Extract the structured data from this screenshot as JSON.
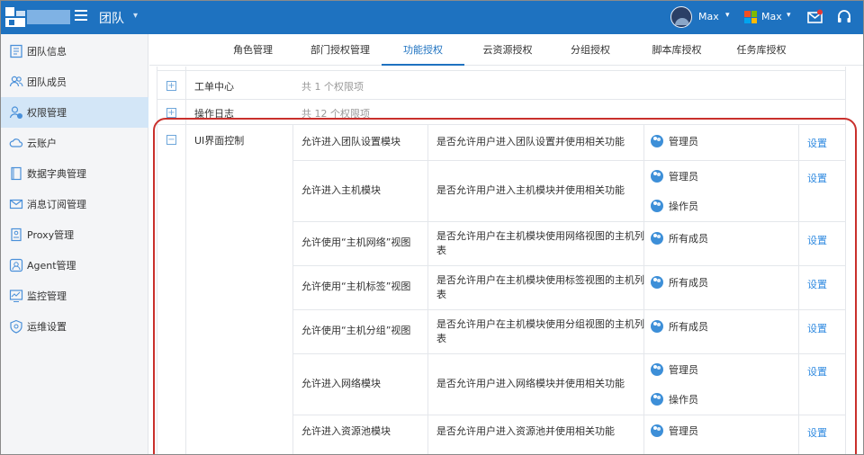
{
  "header": {
    "team_title": "团队",
    "user1_name": "Max",
    "user2_name": "Max"
  },
  "sidebar": {
    "items": [
      {
        "label": "团队信息",
        "icon": "id-card-icon"
      },
      {
        "label": "团队成员",
        "icon": "users-icon"
      },
      {
        "label": "权限管理",
        "icon": "user-permission-icon"
      },
      {
        "label": "云账户",
        "icon": "cloud-icon"
      },
      {
        "label": "数据字典管理",
        "icon": "book-icon"
      },
      {
        "label": "消息订阅管理",
        "icon": "mail-icon"
      },
      {
        "label": "Proxy管理",
        "icon": "proxy-icon"
      },
      {
        "label": "Agent管理",
        "icon": "agent-icon"
      },
      {
        "label": "监控管理",
        "icon": "monitor-icon"
      },
      {
        "label": "运维设置",
        "icon": "shield-gear-icon"
      }
    ]
  },
  "tabs": [
    "角色管理",
    "部门授权管理",
    "功能授权",
    "云资源授权",
    "分组授权",
    "脚本库授权",
    "任务库授权"
  ],
  "groups": [
    {
      "name": "工单中心",
      "count": "共 1 个权限项"
    },
    {
      "name": "操作日志",
      "count": "共 12 个权限项"
    },
    {
      "name": "UI界面控制"
    }
  ],
  "rows": [
    {
      "name": "允许进入团队设置模块",
      "desc": "是否允许用户进入团队设置并使用相关功能",
      "roles": [
        "管理员"
      ],
      "action": "设置"
    },
    {
      "name": "允许进入主机模块",
      "desc": "是否允许用户进入主机模块并使用相关功能",
      "roles": [
        "管理员",
        "操作员"
      ],
      "action": "设置"
    },
    {
      "name": "允许使用“主机网络”视图",
      "desc1": "是否允许用户在主机模块使用网络视图的主机列",
      "desc2": "表",
      "roles": [
        "所有成员"
      ],
      "action": "设置"
    },
    {
      "name": "允许使用“主机标签”视图",
      "desc1": "是否允许用户在主机模块使用标签视图的主机列",
      "desc2": "表",
      "roles": [
        "所有成员"
      ],
      "action": "设置"
    },
    {
      "name": "允许使用“主机分组”视图",
      "desc1": "是否允许用户在主机模块使用分组视图的主机列",
      "desc2": "表",
      "roles": [
        "所有成员"
      ],
      "action": "设置"
    },
    {
      "name": "允许进入网络模块",
      "desc": "是否允许用户进入网络模块并使用相关功能",
      "roles": [
        "管理员",
        "操作员"
      ],
      "action": "设置"
    },
    {
      "name": "允许进入资源池模块",
      "desc": "是否允许用户进入资源池并使用相关功能",
      "roles": [
        "管理员"
      ],
      "action": "设置"
    }
  ],
  "colors": {
    "primary": "#1e72c0",
    "active_nav": "#d3e6f7",
    "link": "#2f8ae0",
    "annotation": "#c9302c"
  }
}
